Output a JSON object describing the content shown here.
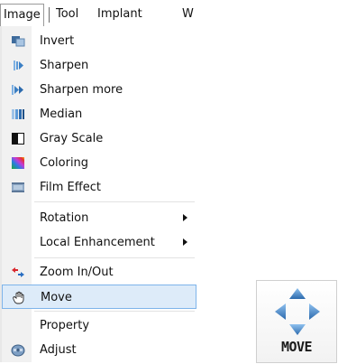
{
  "menubar": {
    "items": [
      {
        "label": "Image"
      },
      {
        "label": "Tool"
      },
      {
        "label": "Implant"
      },
      {
        "label": "W"
      }
    ]
  },
  "menu": {
    "items": [
      {
        "label": "Invert",
        "icon": "invert-icon"
      },
      {
        "label": "Sharpen",
        "icon": "sharpen-icon"
      },
      {
        "label": "Sharpen more",
        "icon": "sharpen-more-icon"
      },
      {
        "label": "Median",
        "icon": "median-icon"
      },
      {
        "label": "Gray Scale",
        "icon": "gray-scale-icon"
      },
      {
        "label": "Coloring",
        "icon": "coloring-icon"
      },
      {
        "label": "Film Effect",
        "icon": "film-effect-icon"
      },
      {
        "label": "Rotation",
        "submenu": true
      },
      {
        "label": "Local Enhancement",
        "submenu": true
      },
      {
        "label": "Zoom In/Out",
        "icon": "zoom-icon"
      },
      {
        "label": "Move",
        "icon": "hand-icon",
        "highlighted": true
      },
      {
        "label": "Property"
      },
      {
        "label": "Adjust",
        "icon": "adjust-icon"
      }
    ]
  },
  "tool_button": {
    "label": "MOVE",
    "icon": "move-arrows-icon"
  },
  "colors": {
    "highlight": "#ddebf9",
    "highlight_border": "#7eb4ea",
    "arrow_blue": "#3a7fc4"
  }
}
